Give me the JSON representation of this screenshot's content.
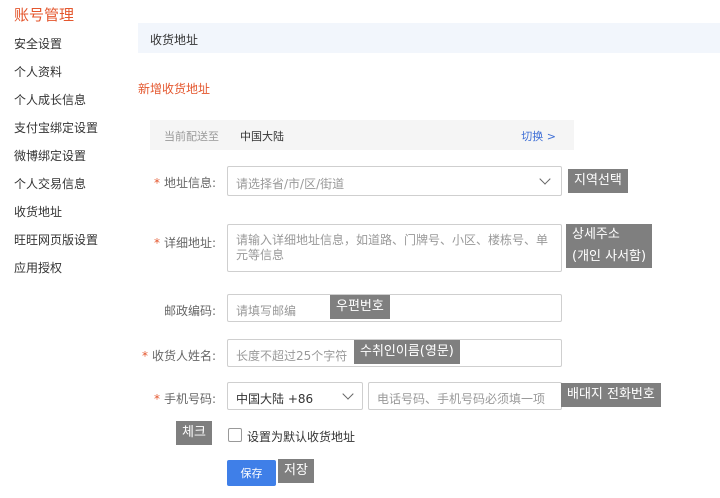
{
  "sidebar": {
    "title": "账号管理",
    "items": [
      {
        "label": "安全设置"
      },
      {
        "label": "个人资料"
      },
      {
        "label": "个人成长信息"
      },
      {
        "label": "支付宝绑定设置"
      },
      {
        "label": "微博绑定设置"
      },
      {
        "label": "个人交易信息"
      },
      {
        "label": "收货地址"
      },
      {
        "label": "旺旺网页版设置"
      },
      {
        "label": "应用授权"
      }
    ]
  },
  "header": {
    "title": "收货地址"
  },
  "new_address": "新增收货地址",
  "delivery": {
    "label": "当前配送至",
    "value": "中国大陆",
    "switch": "切换 >"
  },
  "form": {
    "required_mark": "*",
    "region": {
      "label": "地址信息:",
      "placeholder": "请选择省/市/区/街道",
      "annotation": "지역선택"
    },
    "detail": {
      "label": "详细地址:",
      "placeholder": "请输入详细地址信息，如道路、门牌号、小区、楼栋号、单元等信息",
      "annotation_line1": "상세주소",
      "annotation_line2": "(개인 사서함)"
    },
    "postal": {
      "label": "邮政编码:",
      "placeholder": "请填写邮编",
      "annotation": "우편번호"
    },
    "name": {
      "label": "收货人姓名:",
      "placeholder": "长度不超过25个字符",
      "annotation": "수취인이름(영문)"
    },
    "phone": {
      "label": "手机号码:",
      "country": "中国大陆 +86",
      "placeholder": "电话号码、手机号码必须填一项",
      "annotation": "배대지 전화번호"
    },
    "default": {
      "label": "设置为默认收货地址",
      "annotation": "체크"
    },
    "save": {
      "label": "保存",
      "annotation": "저장"
    }
  }
}
